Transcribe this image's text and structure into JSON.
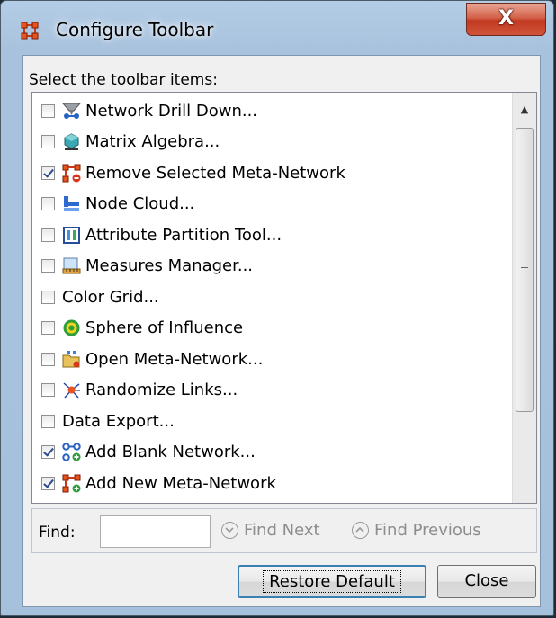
{
  "window": {
    "title": "Configure Toolbar",
    "close_glyph": "X"
  },
  "list": {
    "label": "Select the toolbar items:",
    "items": [
      {
        "label": "Network Drill Down...",
        "checked": false,
        "icon": "drill-down-icon"
      },
      {
        "label": "Matrix Algebra...",
        "checked": false,
        "icon": "matrix-algebra-icon"
      },
      {
        "label": "Remove Selected Meta-Network",
        "checked": true,
        "icon": "remove-meta-network-icon"
      },
      {
        "label": "Node Cloud...",
        "checked": false,
        "icon": "node-cloud-icon"
      },
      {
        "label": "Attribute Partition Tool...",
        "checked": false,
        "icon": "attribute-partition-icon"
      },
      {
        "label": "Measures Manager...",
        "checked": false,
        "icon": "measures-manager-icon"
      },
      {
        "label": "Color Grid...",
        "checked": false,
        "icon": ""
      },
      {
        "label": "Sphere of Influence",
        "checked": false,
        "icon": "sphere-of-influence-icon"
      },
      {
        "label": "Open Meta-Network...",
        "checked": false,
        "icon": "open-meta-network-icon"
      },
      {
        "label": "Randomize Links...",
        "checked": false,
        "icon": "randomize-links-icon"
      },
      {
        "label": "Data Export...",
        "checked": false,
        "icon": ""
      },
      {
        "label": "Add Blank Network...",
        "checked": true,
        "icon": "add-blank-network-icon"
      },
      {
        "label": "Add New Meta-Network",
        "checked": true,
        "icon": "add-meta-network-icon"
      }
    ]
  },
  "find": {
    "label": "Find:",
    "value": "",
    "next_label": "Find Next",
    "prev_label": "Find Previous"
  },
  "buttons": {
    "restore_label": "Restore Default",
    "close_label": "Close"
  },
  "colors": {
    "accent": "#3c7fb1",
    "title_bar": "#b4cde6",
    "close_red": "#c13920"
  }
}
